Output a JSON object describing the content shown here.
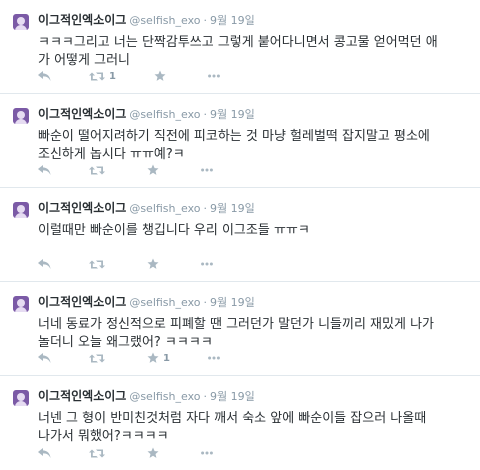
{
  "tweets": [
    {
      "name": "이그적인엑소이그",
      "handle": "@selfish_exo",
      "separator": "·",
      "time": "9월 19일",
      "text": "ㅋㅋㅋ그리고 너는 단짝감투쓰고 그렇게 붙어다니면서 콩고물 얻어먹던 애\n가 어떻게 그러니",
      "retweet_count": "1",
      "favorite_count": ""
    },
    {
      "name": "이그적인엑소이그",
      "handle": "@selfish_exo",
      "separator": "·",
      "time": "9월 19일",
      "text": "빠순이 떨어지려하기 직전에 피코하는 것 마냥 헐레벌떡 잡지말고 평소에\n조신하게 놉시다 ㅠㅠ예?ㅋ",
      "retweet_count": "",
      "favorite_count": ""
    },
    {
      "name": "이그적인엑소이그",
      "handle": "@selfish_exo",
      "separator": "·",
      "time": "9월 19일",
      "text": "이럴때만 빠순이를 챙깁니다 우리 이그조들 ㅠㅠㅋ",
      "retweet_count": "",
      "favorite_count": ""
    },
    {
      "name": "이그적인엑소이그",
      "handle": "@selfish_exo",
      "separator": "·",
      "time": "9월 19일",
      "text": "너네 동료가 정신적으로 피폐할 땐 그러던가 말던가 니들끼리 재밌게 나가\n놀더니 오늘 왜그랬어? ㅋㅋㅋㅋ",
      "retweet_count": "",
      "favorite_count": "1"
    },
    {
      "name": "이그적인엑소이그",
      "handle": "@selfish_exo",
      "separator": "·",
      "time": "9월 19일",
      "text": "너넨 그 형이 반미친것처럼 자다 깨서 숙소 앞에 빠순이들 잡으러 나올때\n나가서 뭐했어?ㅋㅋㅋㅋ",
      "retweet_count": "",
      "favorite_count": ""
    }
  ],
  "icons": {
    "reply": "reply-icon",
    "retweet": "retweet-icon",
    "favorite": "favorite-star-icon",
    "more": "more-dots-icon"
  },
  "colors": {
    "text": "#292f33",
    "muted": "#8899a6",
    "icon": "#aab8c2",
    "divider": "#e1e8ed",
    "avatar": "#7b5aa6"
  }
}
